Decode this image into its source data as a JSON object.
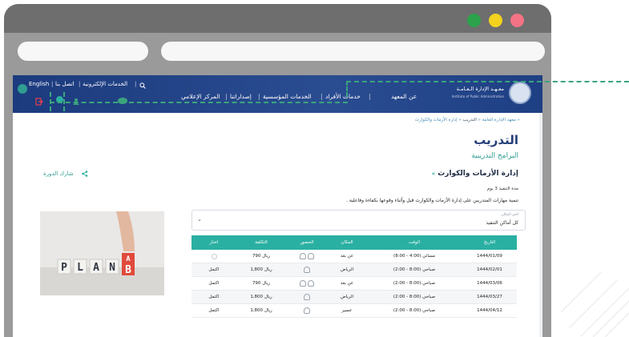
{
  "colors": {
    "header_bg": "#1c3b7e",
    "accent_teal": "#2ab0a2",
    "title_blue": "#243e78",
    "annotation_green": "#3aa57c",
    "traffic_green": "#2ca24d",
    "traffic_yellow": "#f2d21f",
    "traffic_red": "#f47385"
  },
  "header": {
    "lang": "English",
    "contact": "اتصل بنا",
    "eservices": "الخدمات الإلكترونية",
    "logo_ar": "معـهـد الإدارة الـعـامـة",
    "logo_en": "Institute of Public Administration",
    "nav": {
      "about": "عن المعهد",
      "individuals": "خدمات الأفراد",
      "corporate": "الخدمات المؤسسية",
      "publications": "إصداراتنا",
      "media": "المركز الإعلامي"
    }
  },
  "breadcrumb": {
    "home": "معهد الإدارة العامة",
    "training": "التدريب",
    "current": "إدارة الأزمات والكوارث"
  },
  "content": {
    "page_title": "التدريب",
    "section_title": "البرامج التدريبية",
    "course_title": "إدارة الأزمات والكوارث",
    "duration": "مدة التنفيذ 3 يوم",
    "description": "تنمية مهارات المتدربين على إدارة الأزمات والكوارث قبل وأثناء وقوعها بكفاءة وفاعلية .",
    "share": "شارك الدورة"
  },
  "select": {
    "label": "اختر المكان",
    "value": "كل أماكن التنفيذ"
  },
  "image": {
    "letters": [
      "P",
      "L",
      "A",
      "N"
    ],
    "flip_top": "A",
    "flip_bottom": "B"
  },
  "table": {
    "headers": {
      "date": "التاريخ",
      "time": "الوقت",
      "place": "المكان",
      "attendance": "الحضور",
      "cost": "التكلفة",
      "choose": "اختار"
    },
    "rows": [
      {
        "date": "1444/01/09",
        "time": "مسائي (4:00 - 8:00)",
        "place": "عن بعد",
        "cost": "790 ريال",
        "choose": ""
      },
      {
        "date": "1444/02/01",
        "time": "صباحي (8:00 - 2:00)",
        "place": "الرياض",
        "cost": "1,800 ريال",
        "choose": "اكتمل"
      },
      {
        "date": "1444/03/06",
        "time": "صباحي (8:00 - 2:00)",
        "place": "عن بعد",
        "cost": "790 ريال",
        "choose": "اكتمل"
      },
      {
        "date": "1444/03/27",
        "time": "صباحي (8:00 - 2:00)",
        "place": "الرياض",
        "cost": "1,800 ريال",
        "choose": "اكتمل"
      },
      {
        "date": "1444/04/12",
        "time": "صباحي (8:00 - 2:00)",
        "place": "عسير",
        "cost": "1,800 ريال",
        "choose": "اكتمل"
      }
    ]
  }
}
